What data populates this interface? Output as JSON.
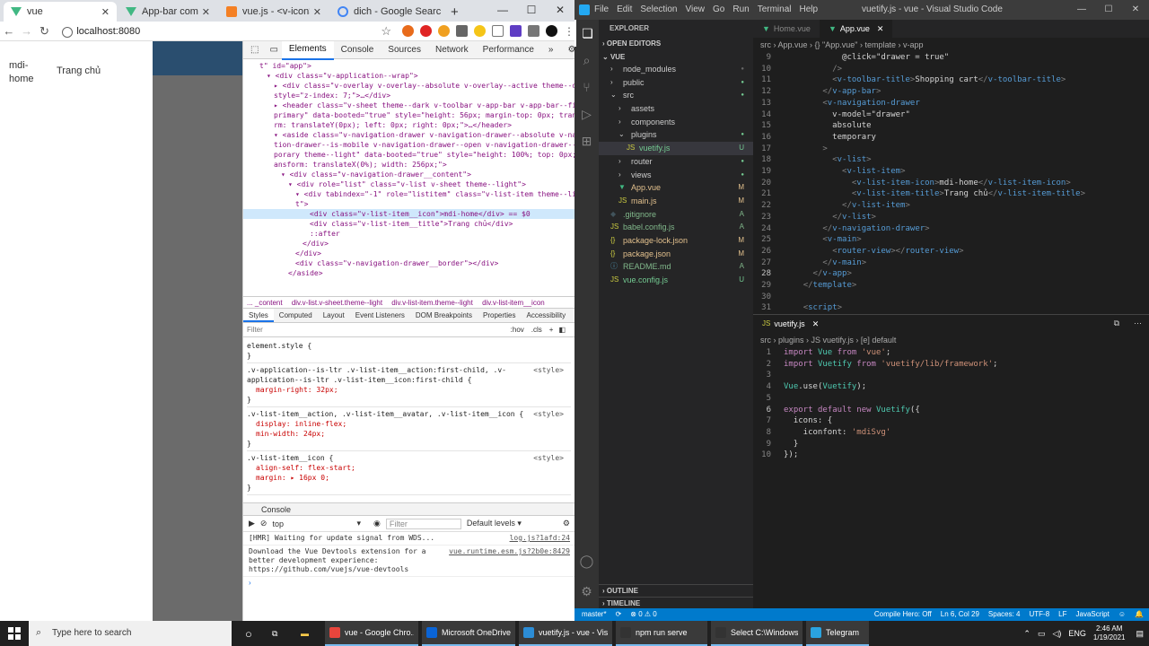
{
  "chrome": {
    "tabs": [
      {
        "title": "vue",
        "active": true
      },
      {
        "title": "App-bar component —",
        "active": false
      },
      {
        "title": "vue.js - <v-icon> vue",
        "active": false
      },
      {
        "title": "dich - Google Search",
        "active": false
      }
    ],
    "new_tab": "+",
    "url": "localhost:8080"
  },
  "page": {
    "drawer_icon_text": "mdi-home",
    "drawer_item": "Trang chủ"
  },
  "devtools": {
    "tabs": [
      "Elements",
      "Console",
      "Sources",
      "Network",
      "Performance"
    ],
    "more": "»",
    "dom": [
      {
        "text": "t\" id=\"app\">",
        "sel": false
      },
      {
        "text": "▾ <div class=\"v-application--wrap\">",
        "sel": false
      },
      {
        "text": "▸ <div class=\"v-overlay v-overlay--absolute v-overlay--active theme--dark\"",
        "sel": false
      },
      {
        "text": "style=\"z-index: 7;\">…</div>",
        "sel": false
      },
      {
        "text": "▸ <header class=\"v-sheet theme--dark v-toolbar v-app-bar v-app-bar--fixed",
        "sel": false
      },
      {
        "text": "primary\" data-booted=\"true\" style=\"height: 56px; margin-top: 0px; transfo",
        "sel": false
      },
      {
        "text": "rm: translateY(0px); left: 0px; right: 0px;\">…</header>",
        "sel": false
      },
      {
        "text": "▾ <aside class=\"v-navigation-drawer v-navigation-drawer--absolute v-naviga",
        "sel": false
      },
      {
        "text": "tion-drawer--is-mobile v-navigation-drawer--open v-navigation-drawer--tem",
        "sel": false
      },
      {
        "text": "porary theme--light\" data-booted=\"true\" style=\"height: 100%; top: 0px; tr",
        "sel": false
      },
      {
        "text": "ansform: translateX(0%); width: 256px;\">",
        "sel": false
      },
      {
        "text": "▾ <div class=\"v-navigation-drawer__content\">",
        "sel": false
      },
      {
        "text": "▾ <div role=\"list\" class=\"v-list v-sheet theme--light\">",
        "sel": false
      },
      {
        "text": "▾ <div tabindex=\"-1\" role=\"listitem\" class=\"v-list-item theme--ligh",
        "sel": false
      },
      {
        "text": "t\">",
        "sel": false
      },
      {
        "text": "<div class=\"v-list-item__icon\">mdi-home</div> == $0",
        "sel": true
      },
      {
        "text": "<div class=\"v-list-item__title\">Trang chủ</div>",
        "sel": false
      },
      {
        "text": "::after",
        "sel": false
      },
      {
        "text": "</div>",
        "sel": false
      },
      {
        "text": "</div>",
        "sel": false
      },
      {
        "text": "<div class=\"v-navigation-drawer__border\"></div>",
        "sel": false
      },
      {
        "text": "</aside>",
        "sel": false
      }
    ],
    "crumbs": [
      "... _content",
      "div.v-list.v-sheet.theme--light",
      "div.v-list-item.theme--light",
      "div.v-list-item__icon"
    ],
    "style_tabs": [
      "Styles",
      "Computed",
      "Layout",
      "Event Listeners",
      "DOM Breakpoints",
      "Properties",
      "Accessibility"
    ],
    "filter_placeholder": "Filter",
    "hov": ":hov",
    "cls": ".cls",
    "rules": [
      {
        "sel": "element.style {",
        "props": [],
        "src": ""
      },
      {
        "sel": ".v-application--is-ltr .v-list-item__action:first-child, .v-application--is-ltr .v-list-item__icon:first-child {",
        "props": [
          "margin-right: 32px;"
        ],
        "src": "<style>"
      },
      {
        "sel": ".v-list-item__action, .v-list-item__avatar, .v-list-item__icon {",
        "props": [
          "display: inline-flex;",
          "min-width: 24px;"
        ],
        "src": "<style>"
      },
      {
        "sel": ".v-list-item__icon {",
        "props": [
          "align-self: flex-start;",
          "margin: ▸ 16px 0;"
        ],
        "src": "<style>"
      },
      {
        "sel": "* {",
        "props": [],
        "src": "<style>"
      }
    ],
    "console": {
      "tab": "Console",
      "context": "top",
      "filter": "Filter",
      "levels": "Default levels ▾",
      "messages": [
        {
          "text": "[HMR] Waiting for update signal from WDS...",
          "src": "log.js?1afd:24"
        },
        {
          "text": "Download the Vue Devtools extension for a better development experience: https://github.com/vuejs/vue-devtools",
          "src": "vue.runtime.esm.js?2b0e:8429"
        }
      ],
      "prompt": "›"
    }
  },
  "vscode": {
    "menu": [
      "File",
      "Edit",
      "Selection",
      "View",
      "Go",
      "Run",
      "Terminal",
      "Help"
    ],
    "title": "vuetify.js - vue - Visual Studio Code",
    "explorer_title": "EXPLORER",
    "open_editors": "OPEN EDITORS",
    "root": "VUE",
    "files": [
      {
        "name": "node_modules",
        "indent": 1,
        "type": "dir",
        "status": "",
        "dot": "#666"
      },
      {
        "name": "public",
        "indent": 1,
        "type": "dir",
        "status": "",
        "dot": "#73c991"
      },
      {
        "name": "src",
        "indent": 1,
        "type": "dir-open",
        "status": "",
        "dot": "#73c991"
      },
      {
        "name": "assets",
        "indent": 2,
        "type": "dir",
        "status": "",
        "dot": ""
      },
      {
        "name": "components",
        "indent": 2,
        "type": "dir",
        "status": "",
        "dot": ""
      },
      {
        "name": "plugins",
        "indent": 2,
        "type": "dir-open",
        "status": "",
        "dot": "#73c991"
      },
      {
        "name": "vuetify.js",
        "indent": 3,
        "type": "js",
        "status": "U",
        "dot": ""
      },
      {
        "name": "router",
        "indent": 2,
        "type": "dir",
        "status": "",
        "dot": "#73c991"
      },
      {
        "name": "views",
        "indent": 2,
        "type": "dir",
        "status": "",
        "dot": "#73c991"
      },
      {
        "name": "App.vue",
        "indent": 2,
        "type": "vue",
        "status": "M",
        "dot": ""
      },
      {
        "name": "main.js",
        "indent": 2,
        "type": "js",
        "status": "M",
        "dot": ""
      },
      {
        "name": ".gitignore",
        "indent": 1,
        "type": "git",
        "status": "A",
        "dot": ""
      },
      {
        "name": "babel.config.js",
        "indent": 1,
        "type": "js",
        "status": "A",
        "dot": ""
      },
      {
        "name": "package-lock.json",
        "indent": 1,
        "type": "json",
        "status": "M",
        "dot": ""
      },
      {
        "name": "package.json",
        "indent": 1,
        "type": "json",
        "status": "M",
        "dot": ""
      },
      {
        "name": "README.md",
        "indent": 1,
        "type": "md",
        "status": "A",
        "dot": ""
      },
      {
        "name": "vue.config.js",
        "indent": 1,
        "type": "js",
        "status": "U",
        "dot": ""
      }
    ],
    "outline": "OUTLINE",
    "timeline": "TIMELINE",
    "top_tabs": [
      "Home.vue",
      "App.vue"
    ],
    "top_breadcrumb": "src › App.vue › {} \"App.vue\" › template › v-app",
    "top_code": [
      {
        "n": "9",
        "t": "            @click=\"drawer = true\""
      },
      {
        "n": "10",
        "t": "          />"
      },
      {
        "n": "11",
        "t": "          <v-toolbar-title>Shopping cart</v-toolbar-title>"
      },
      {
        "n": "12",
        "t": "        </v-app-bar>"
      },
      {
        "n": "13",
        "t": "        <v-navigation-drawer"
      },
      {
        "n": "14",
        "t": "          v-model=\"drawer\""
      },
      {
        "n": "15",
        "t": "          absolute"
      },
      {
        "n": "16",
        "t": "          temporary"
      },
      {
        "n": "17",
        "t": "        >"
      },
      {
        "n": "18",
        "t": "          <v-list>"
      },
      {
        "n": "19",
        "t": "            <v-list-item>"
      },
      {
        "n": "20",
        "t": "              <v-list-item-icon>mdi-home</v-list-item-icon>"
      },
      {
        "n": "21",
        "t": "              <v-list-item-title>Trang chủ</v-list-item-title>"
      },
      {
        "n": "22",
        "t": "            </v-list-item>"
      },
      {
        "n": "23",
        "t": "          </v-list>"
      },
      {
        "n": "24",
        "t": "        </v-navigation-drawer>"
      },
      {
        "n": "25",
        "t": "        <v-main>"
      },
      {
        "n": "26",
        "t": "          <router-view></router-view>"
      },
      {
        "n": "27",
        "t": "        </v-main>"
      },
      {
        "n": "28",
        "t": "      </v-app>"
      },
      {
        "n": "29",
        "t": "    </template>"
      },
      {
        "n": "30",
        "t": ""
      },
      {
        "n": "31",
        "t": "    <script>"
      }
    ],
    "bottom_tab": "vuetify.js",
    "bottom_breadcrumb": "src › plugins › JS vuetify.js › [e] default",
    "bottom_code": [
      {
        "n": "1",
        "t": "import Vue from 'vue';"
      },
      {
        "n": "2",
        "t": "import Vuetify from 'vuetify/lib/framework';"
      },
      {
        "n": "3",
        "t": ""
      },
      {
        "n": "4",
        "t": "Vue.use(Vuetify);"
      },
      {
        "n": "5",
        "t": ""
      },
      {
        "n": "6",
        "t": "export default new Vuetify({"
      },
      {
        "n": "7",
        "t": "  icons: {"
      },
      {
        "n": "8",
        "t": "    iconfont: 'mdiSvg'"
      },
      {
        "n": "9",
        "t": "  }"
      },
      {
        "n": "10",
        "t": "});"
      }
    ],
    "status_left": [
      "master*",
      "⊗ 0 ⚠ 0"
    ],
    "status_right": [
      "Compile Hero: Off",
      "Ln 6, Col 29",
      "Spaces: 4",
      "UTF-8",
      "LF",
      "JavaScript"
    ]
  },
  "taskbar": {
    "search": "Type here to search",
    "apps": [
      {
        "label": "vue - Google Chro...",
        "color": "#e8453c"
      },
      {
        "label": "Microsoft OneDrive",
        "color": "#0a64d6"
      },
      {
        "label": "vuetify.js - vue - Vis...",
        "color": "#2c8dd6"
      },
      {
        "label": "npm run serve",
        "color": "#333"
      },
      {
        "label": "Select C:\\Windows...",
        "color": "#333"
      },
      {
        "label": "Telegram",
        "color": "#2aa3df"
      }
    ],
    "lang": "ENG",
    "time": "2:46 AM",
    "date": "1/19/2021"
  }
}
